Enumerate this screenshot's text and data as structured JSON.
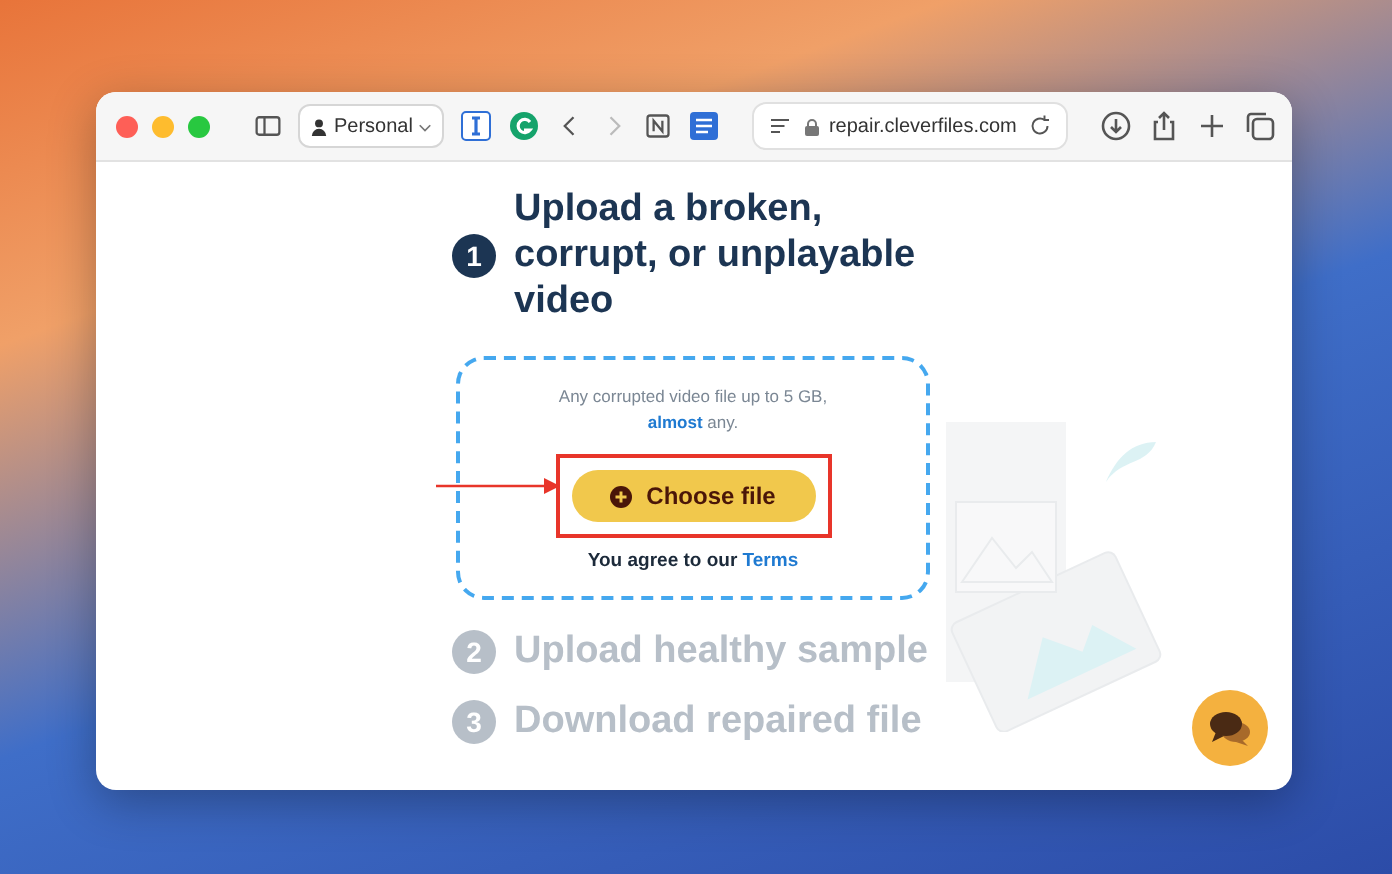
{
  "browser": {
    "profile": "Personal",
    "url": "repair.cleverfiles.com"
  },
  "steps": [
    {
      "number": "1",
      "title": "Upload a broken, corrupt, or unplayable video",
      "active": true,
      "upload": {
        "note": "Any corrupted video file up to 5 GB,",
        "link": "almost",
        "note_end": "any.",
        "button": "Choose file",
        "agree": "You agree to our",
        "terms": "Terms"
      }
    },
    {
      "number": "2",
      "title": "Upload healthy sample",
      "active": false
    },
    {
      "number": "3",
      "title": "Download repaired file",
      "active": false
    }
  ]
}
